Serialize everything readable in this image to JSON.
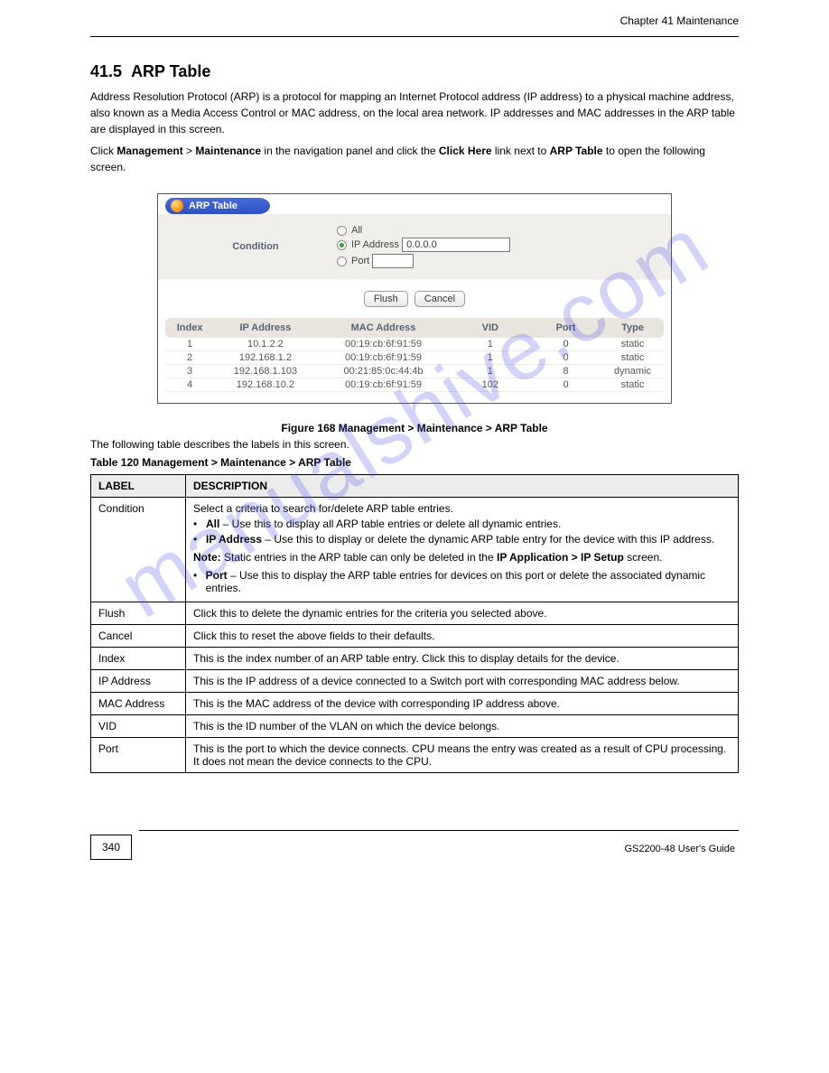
{
  "header": {
    "chapter": "Chapter 41 Maintenance"
  },
  "section": {
    "number": "41.5",
    "title": "ARP Table",
    "para1": "Address Resolution Protocol (ARP) is a protocol for mapping an Internet Protocol address (IP address) to a physical machine address, also known as a Media Access Control or MAC address, on the local area network. IP addresses and MAC addresses in the ARP table are displayed in this screen.",
    "para2_prefix": "Click ",
    "para2_b1": "Management",
    "para2_mid": " > ",
    "para2_b2": "Maintenance",
    "para2_mid2": " in the navigation panel and click the ",
    "para2_b3": "Click Here",
    "para2_mid3": " link next to ",
    "para2_b4": "ARP Table",
    "para2_suffix": " to open the following screen."
  },
  "screenshot": {
    "pill_title": "ARP Table",
    "condition_label": "Condition",
    "radio_all": "All",
    "radio_ip_label": "IP Address",
    "radio_ip_value": "0.0.0.0",
    "radio_port_label": "Port",
    "btn_flush": "Flush",
    "btn_cancel": "Cancel",
    "columns": {
      "index": "Index",
      "ip": "IP Address",
      "mac": "MAC Address",
      "vid": "VID",
      "port": "Port",
      "type": "Type"
    },
    "rows": [
      {
        "idx": "1",
        "ip": "10.1.2.2",
        "mac": "00:19:cb:6f:91:59",
        "vid": "1",
        "port": "0",
        "type": "static"
      },
      {
        "idx": "2",
        "ip": "192.168.1.2",
        "mac": "00:19:cb:6f:91:59",
        "vid": "1",
        "port": "0",
        "type": "static"
      },
      {
        "idx": "3",
        "ip": "192.168.1.103",
        "mac": "00:21:85:0c:44:4b",
        "vid": "1",
        "port": "8",
        "type": "dynamic"
      },
      {
        "idx": "4",
        "ip": "192.168.10.2",
        "mac": "00:19:cb:6f:91:59",
        "vid": "102",
        "port": "0",
        "type": "static"
      }
    ]
  },
  "figure_caption": "Figure 168   Management > Maintenance > ARP Table",
  "desc_caption": "The following table describes the labels in this screen.",
  "desc_table_title": "Table 120   Management > Maintenance > ARP Table",
  "desc": {
    "h_label": "LABEL",
    "h_desc": "DESCRIPTION",
    "r1_label": "Condition",
    "r1_intro": "Select a criteria to search for/delete ARP table entries.",
    "r1_b1_b": "All",
    "r1_b1_t": " – Use this to display all ARP table entries or delete all dynamic entries.",
    "r1_b2_b": "IP Address",
    "r1_b2_t": " – Use this to display or delete the dynamic ARP table entry for the device with this IP address.",
    "r1_note_b": "Note:",
    "r1_note_t": " Static entries in the ARP table can only be deleted in the ",
    "r1_note_b2": "IP Application > IP Setup",
    "r1_note_t2": " screen.",
    "r1_b3_b": "Port",
    "r1_b3_t": " – Use this to display the ARP table entries for devices on this port or delete the associated dynamic entries.",
    "r2_label": "Flush",
    "r2_desc": "Click this to delete the dynamic entries for the criteria you selected above.",
    "r3_label": "Cancel",
    "r3_desc": "Click this to reset the above fields to their defaults.",
    "r4_label": "Index",
    "r4_desc": "This is the index number of an ARP table entry. Click this to display details for the device.",
    "r5_label": "IP Address",
    "r5_desc": "This is the IP address of a device connected to a Switch port with corresponding MAC address below.",
    "r6_label": "MAC Address",
    "r6_desc": "This is the MAC address of the device with corresponding IP address above.",
    "r7_label": "VID",
    "r7_desc": "This is the ID number of the VLAN on which the device belongs.",
    "r8_label": "Port",
    "r8_desc": "This is the port to which the device connects. CPU means the entry was created as a result of CPU processing. It does not mean the device connects to the CPU."
  },
  "footer": {
    "page": "340",
    "text": "GS2200-48 User's Guide"
  },
  "watermark": "manualshive.com"
}
